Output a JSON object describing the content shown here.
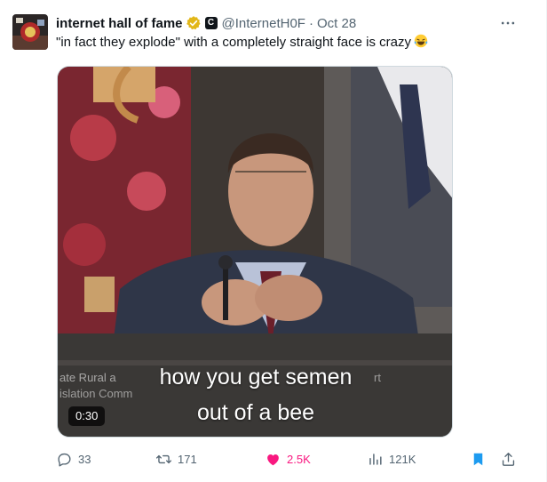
{
  "author": {
    "name": "internet hall of fame",
    "handle": "@InternetH0F",
    "affiliation_badge": "C",
    "date": "Oct 28",
    "separator": "·"
  },
  "tweet": {
    "text": "\"in fact they explode\" with a completely straight face is crazy",
    "emoji": "laughing-crying-face"
  },
  "media": {
    "type": "video",
    "caption_line1": "how you get semen",
    "caption_line2": "out of a bee",
    "duration": "0:30",
    "background_text1": "ate Rural a",
    "background_text2": "islation Comm",
    "background_text3": "rt"
  },
  "actions": {
    "replies": "33",
    "reposts": "171",
    "likes": "2.5K",
    "views": "121K"
  },
  "colors": {
    "text_primary": "#0f1419",
    "text_secondary": "#536471",
    "like_active": "#f91880",
    "bookmark_active": "#1d9bf0",
    "verified_gold": "#e2b719"
  },
  "icons": [
    "more-icon",
    "verified-gold-icon",
    "reply-icon",
    "repost-icon",
    "like-icon",
    "views-icon",
    "bookmark-icon",
    "share-icon"
  ]
}
